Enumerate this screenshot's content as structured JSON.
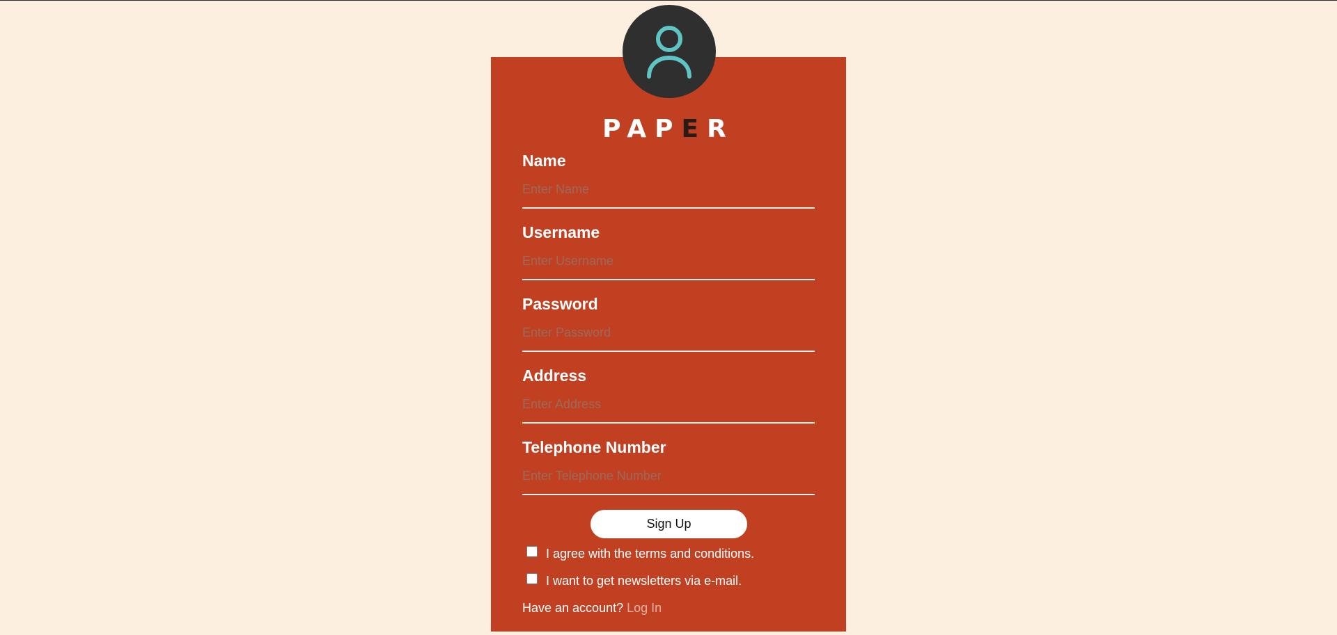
{
  "brand": {
    "logo_parts": [
      "PAP",
      "E",
      "R"
    ]
  },
  "avatar": {
    "icon": "user-icon",
    "ring_color": "#5fc4c4"
  },
  "colors": {
    "page_background": "#fdefdf",
    "card_background": "#c14022",
    "avatar_background": "#2f2f2f"
  },
  "form": {
    "fields": [
      {
        "label": "Name",
        "placeholder": "Enter Name",
        "value": ""
      },
      {
        "label": "Username",
        "placeholder": "Enter Username",
        "value": ""
      },
      {
        "label": "Password",
        "placeholder": "Enter Password",
        "value": ""
      },
      {
        "label": "Address",
        "placeholder": "Enter Address",
        "value": ""
      },
      {
        "label": "Telephone Number",
        "placeholder": "Enter Telephone Number",
        "value": ""
      }
    ],
    "submit_label": "Sign Up",
    "checkboxes": [
      {
        "label": "I agree with the terms and conditions.",
        "checked": false
      },
      {
        "label": "I want to get newsletters via e-mail.",
        "checked": false
      }
    ],
    "account_prompt": "Have an account?",
    "login_label": "Log In"
  }
}
